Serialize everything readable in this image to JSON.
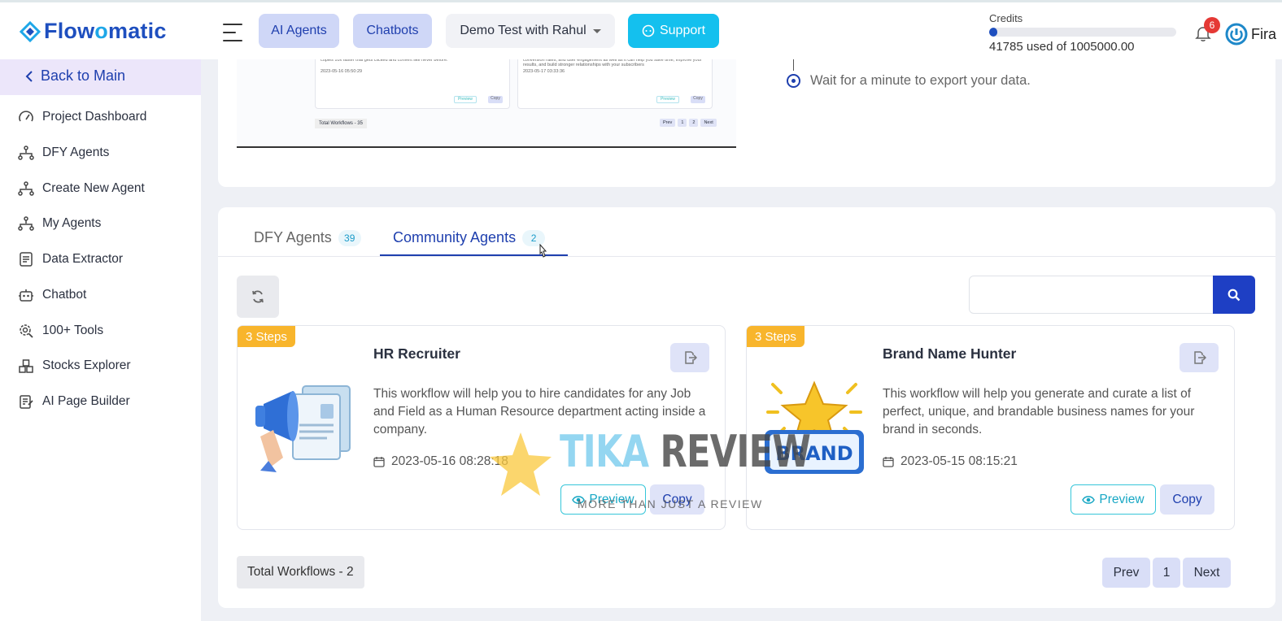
{
  "brand": {
    "name_prefix": "Flow",
    "name_o": "o",
    "name_suffix": "matic",
    "accent": "#1e4fbf",
    "accent_light": "#1ea7e8"
  },
  "header": {
    "ai_agents_label": "AI Agents",
    "chatbots_label": "Chatbots",
    "project_label": "Demo Test with Rahul",
    "support_label": "Support",
    "credits_label": "Credits",
    "credits_used_text": "41785 used of 1005000.00",
    "credits_fraction": 0.0416,
    "notification_count": "6",
    "user_name": "Fira"
  },
  "sidebar": {
    "back_label": "Back to Main",
    "items": [
      {
        "label": "Project Dashboard",
        "icon": "gauge-icon"
      },
      {
        "label": "DFY Agents",
        "icon": "hierarchy-icon"
      },
      {
        "label": "Create New Agent",
        "icon": "hierarchy-icon"
      },
      {
        "label": "My Agents",
        "icon": "hierarchy-icon"
      },
      {
        "label": "Data Extractor",
        "icon": "document-icon"
      },
      {
        "label": "Chatbot",
        "icon": "robot-icon"
      },
      {
        "label": "100+ Tools",
        "icon": "gear-search-icon"
      },
      {
        "label": "Stocks Explorer",
        "icon": "boxes-icon"
      },
      {
        "label": "AI Page Builder",
        "icon": "page-builder-icon"
      }
    ]
  },
  "guide": {
    "step_text": "Wait for a minute to export your data.",
    "mini_total": "Total Workflows - 35",
    "mini_pager": [
      "Prev",
      "1",
      "2",
      "Next"
    ],
    "mini_dates": [
      "2023-05-16 05:50:29",
      "2023-05-17 03:33:36"
    ]
  },
  "tabs": [
    {
      "label": "DFY Agents",
      "count": "39",
      "active": false
    },
    {
      "label": "Community Agents",
      "count": "2",
      "active": true
    }
  ],
  "search": {
    "placeholder": ""
  },
  "cards": [
    {
      "steps": "3 Steps",
      "title": "HR Recruiter",
      "description": "This workflow will help you to hire candidates for any Job and Field as a Human Resource department acting inside a company.",
      "date": "2023-05-16 08:28:18",
      "preview_label": "Preview",
      "copy_label": "Copy",
      "image": "megaphone-resume-illustration"
    },
    {
      "steps": "3 Steps",
      "title": "Brand Name Hunter",
      "description": "This workflow will help you generate and curate a list of perfect, unique, and brandable business names for your brand in seconds.",
      "date": "2023-05-15 08:15:21",
      "preview_label": "Preview",
      "copy_label": "Copy",
      "image": "brand-star-illustration",
      "image_text": "BRAND"
    }
  ],
  "footer": {
    "total_text": "Total Workflows - 2",
    "prev_label": "Prev",
    "page_label": "1",
    "next_label": "Next"
  },
  "watermark": {
    "word1": "TIKA",
    "word2": "REVIEW",
    "tagline": "MORE THAN JUST A REVIEW"
  }
}
